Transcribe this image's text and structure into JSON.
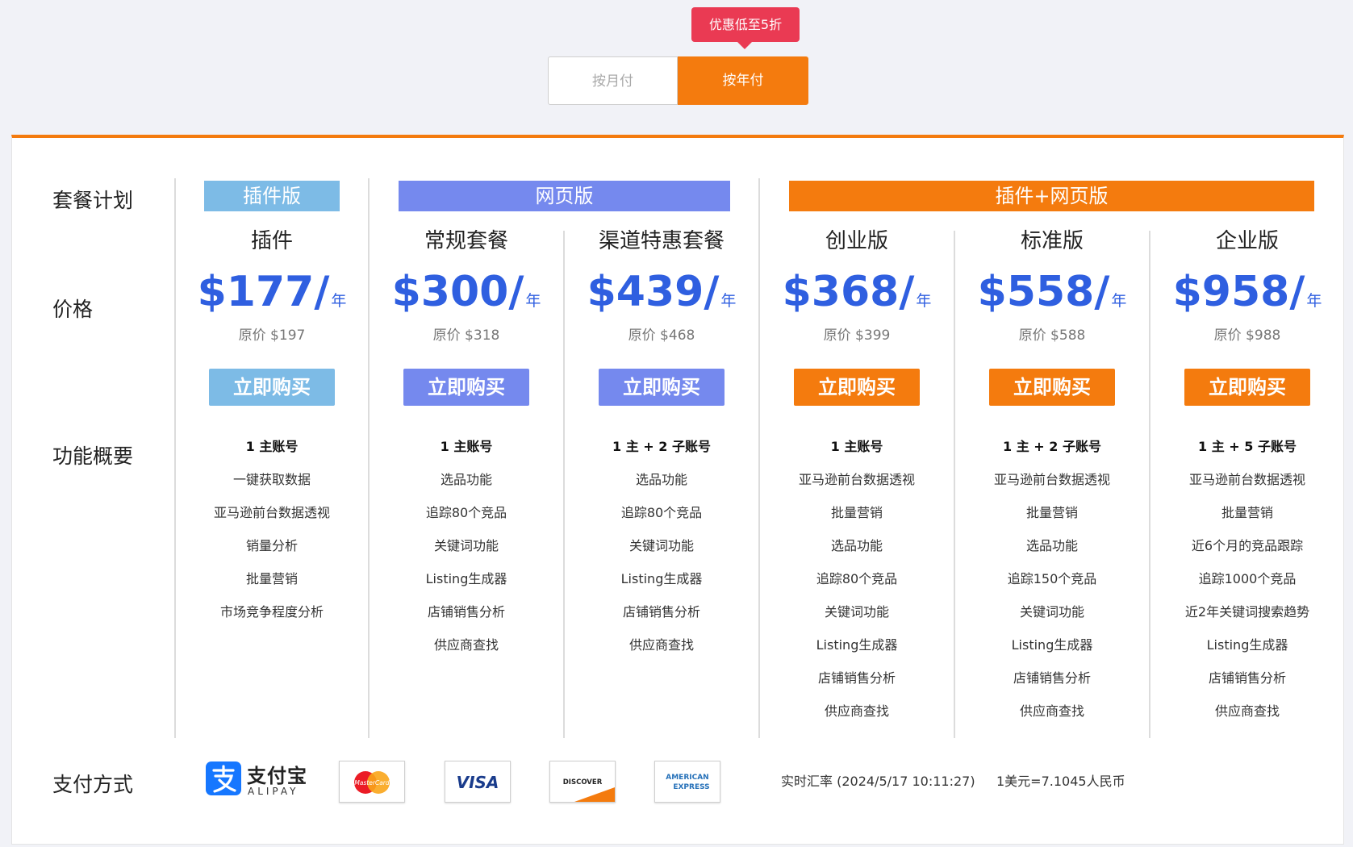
{
  "badge": "优惠低至5折",
  "toggle": {
    "monthly": "按月付",
    "yearly": "按年付"
  },
  "labels": {
    "plan": "套餐计划",
    "price": "价格",
    "features": "功能概要",
    "payment": "支付方式"
  },
  "groups": [
    {
      "name": "插件版",
      "color": "#7dbbe6"
    },
    {
      "name": "网页版",
      "color": "#7589ee"
    },
    {
      "name": "插件+网页版",
      "color": "#f47b0e"
    }
  ],
  "plans": [
    {
      "name": "插件",
      "price": "$177/",
      "unit": "年",
      "original": "原价 $197",
      "buy": "立即购买",
      "button_color": "#7dbbe6",
      "features": [
        "1 主账号",
        "一键获取数据",
        "亚马逊前台数据透视",
        "销量分析",
        "批量营销",
        "市场竞争程度分析"
      ]
    },
    {
      "name": "常规套餐",
      "price": "$300/",
      "unit": "年",
      "original": "原价 $318",
      "buy": "立即购买",
      "button_color": "#7589ee",
      "features": [
        "1 主账号",
        "选品功能",
        "追踪80个竞品",
        "关键词功能",
        "Listing生成器",
        "店铺销售分析",
        "供应商查找"
      ]
    },
    {
      "name": "渠道特惠套餐",
      "price": "$439/",
      "unit": "年",
      "original": "原价 $468",
      "buy": "立即购买",
      "button_color": "#7589ee",
      "features": [
        "1 主 + 2 子账号",
        "选品功能",
        "追踪80个竞品",
        "关键词功能",
        "Listing生成器",
        "店铺销售分析",
        "供应商查找"
      ]
    },
    {
      "name": "创业版",
      "price": "$368/",
      "unit": "年",
      "original": "原价 $399",
      "buy": "立即购买",
      "button_color": "#f47b0e",
      "features": [
        "1 主账号",
        "亚马逊前台数据透视",
        "批量营销",
        "选品功能",
        "追踪80个竞品",
        "关键词功能",
        "Listing生成器",
        "店铺销售分析",
        "供应商查找"
      ]
    },
    {
      "name": "标准版",
      "price": "$558/",
      "unit": "年",
      "original": "原价 $588",
      "buy": "立即购买",
      "button_color": "#f47b0e",
      "features": [
        "1 主 + 2 子账号",
        "亚马逊前台数据透视",
        "批量营销",
        "选品功能",
        "追踪150个竞品",
        "关键词功能",
        "Listing生成器",
        "店铺销售分析",
        "供应商查找"
      ]
    },
    {
      "name": "企业版",
      "price": "$958/",
      "unit": "年",
      "original": "原价 $988",
      "buy": "立即购买",
      "button_color": "#f47b0e",
      "features": [
        "1 主 + 5 子账号",
        "亚马逊前台数据透视",
        "批量营销",
        "近6个月的竞品跟踪",
        "追踪1000个竞品",
        "近2年关键词搜索趋势",
        "Listing生成器",
        "店铺销售分析",
        "供应商查找"
      ]
    }
  ],
  "payment": {
    "alipay_cn": "支付宝",
    "alipay_en": "ALIPAY",
    "mastercard": "MasterCard",
    "visa": "VISA",
    "discover": "DISCOVER",
    "amex_1": "AMERICAN",
    "amex_2": "EXPRESS"
  },
  "rate": {
    "time": "实时汇率 (2024/5/17 10:11:27)",
    "value": "1美元=7.1045人民币"
  }
}
